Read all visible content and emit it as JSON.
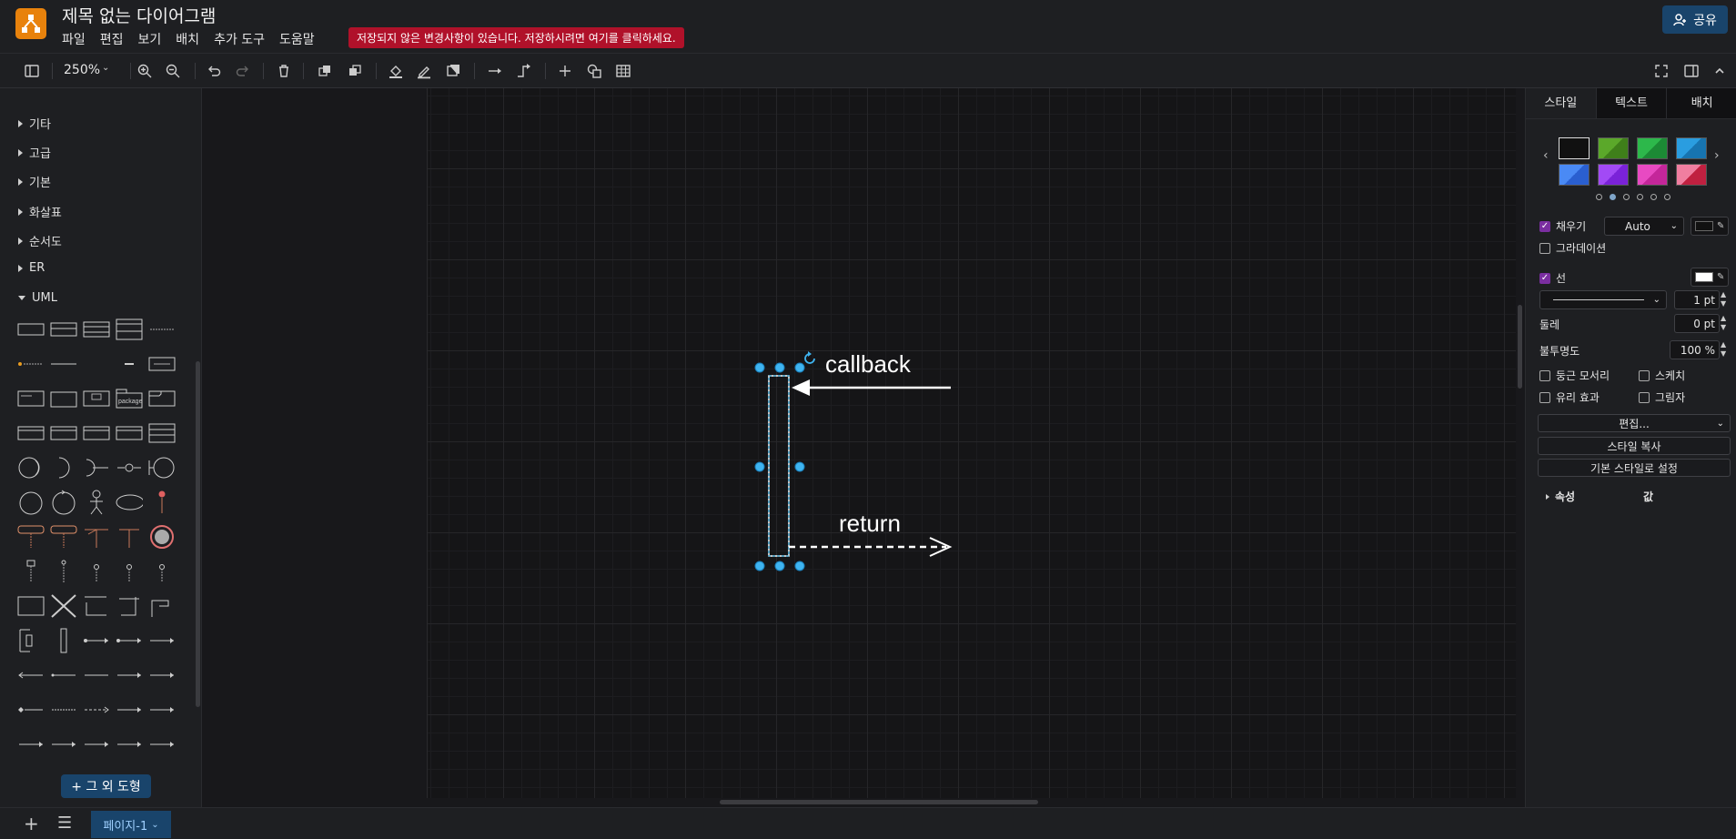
{
  "header": {
    "title": "제목 없는 다이어그램",
    "menu": [
      "파일",
      "편집",
      "보기",
      "배치",
      "추가 도구",
      "도움말"
    ],
    "unsaved_notice": "저장되지 않은 변경사항이 있습니다. 저장하시려면 여기를 클릭하세요.",
    "share_label": "공유"
  },
  "toolbar": {
    "zoom": "250%",
    "icons": [
      "sidebar-toggle-icon",
      "zoom-in-icon",
      "zoom-out-icon",
      "undo-icon",
      "redo-icon",
      "delete-icon",
      "to-front-icon",
      "to-back-icon",
      "fill-color-icon",
      "line-color-icon",
      "shadow-icon",
      "connection-icon",
      "waypoints-icon",
      "insert-icon",
      "shapes-icon",
      "table-icon",
      "fullscreen-icon",
      "format-panel-icon",
      "collapse-icon"
    ]
  },
  "sidebar": {
    "categories": [
      "기타",
      "고급",
      "기본",
      "화살표",
      "순서도",
      "ER",
      "UML"
    ],
    "expanded": "UML",
    "more_shapes": "+ 그 외 도형"
  },
  "diagram": {
    "labels": {
      "callback": "callback",
      "return": "return"
    }
  },
  "format_panel": {
    "tabs": [
      "스타일",
      "텍스트",
      "배치"
    ],
    "swatches": [
      "#111111",
      "#4d9a1f",
      "#1fa33b",
      "#1c8fd6",
      "#2e6fe0",
      "#8a2be2",
      "#d63bb5",
      "#d96a8c"
    ],
    "fill": {
      "label": "채우기",
      "value": "Auto",
      "checked": true
    },
    "gradient": {
      "label": "그라데이션",
      "checked": false
    },
    "line": {
      "label": "선",
      "checked": true,
      "width": "1 pt"
    },
    "perimeter": {
      "label": "둘레",
      "value": "0 pt"
    },
    "opacity": {
      "label": "불투명도",
      "value": "100 %"
    },
    "options": [
      "둥근 모서리",
      "스케치",
      "유리 효과",
      "그림자"
    ],
    "edit_label": "편집...",
    "copy_style": "스타일 복사",
    "set_default": "기본 스타일로 설정",
    "prop_col": "속성",
    "value_col": "값"
  },
  "footer": {
    "page_label": "페이지-1"
  }
}
